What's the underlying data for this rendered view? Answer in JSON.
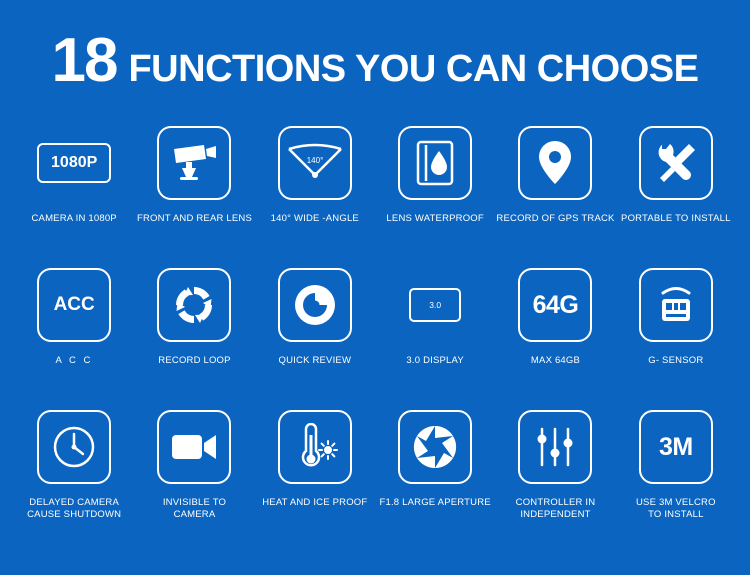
{
  "theme": {
    "background": "#0b64bf",
    "foreground": "#ffffff"
  },
  "heading": {
    "number": "18",
    "text": "FUNCTIONS YOU CAN CHOOSE"
  },
  "features": [
    {
      "id": "camera-1080p",
      "icon": "1080p-badge-icon",
      "tile_text": "1080P",
      "caption": "CAMERA IN 1080P"
    },
    {
      "id": "front-rear-lens",
      "icon": "cctv-camera-icon",
      "tile_text": "",
      "caption": "FRONT AND REAR LENS"
    },
    {
      "id": "wide-angle",
      "icon": "wide-angle-icon",
      "tile_text": "140°",
      "caption": "140° WIDE -ANGLE"
    },
    {
      "id": "lens-waterproof",
      "icon": "waterdrop-icon",
      "tile_text": "",
      "caption": "LENS WATERPROOF"
    },
    {
      "id": "gps-track",
      "icon": "map-pin-icon",
      "tile_text": "",
      "caption": "RECORD OF GPS TRACK"
    },
    {
      "id": "portable-install",
      "icon": "wrench-screwdriver-icon",
      "tile_text": "",
      "caption": "PORTABLE TO INSTALL"
    },
    {
      "id": "acc",
      "icon": "acc-text-icon",
      "tile_text": "ACC",
      "caption": "A C C"
    },
    {
      "id": "record-loop",
      "icon": "loop-arrows-icon",
      "tile_text": "",
      "caption": "RECORD LOOP"
    },
    {
      "id": "quick-review",
      "icon": "play-circle-icon",
      "tile_text": "",
      "caption": "QUICK REVIEW"
    },
    {
      "id": "display-3-0",
      "icon": "screen-icon",
      "tile_text": "3.0",
      "caption": "3.0 DISPLAY"
    },
    {
      "id": "max-64gb",
      "icon": "64g-text-icon",
      "tile_text": "64G",
      "caption": "MAX 64GB"
    },
    {
      "id": "g-sensor",
      "icon": "g-sensor-icon",
      "tile_text": "",
      "caption": "G- SENSOR"
    },
    {
      "id": "delayed-camera",
      "icon": "clock-icon",
      "tile_text": "",
      "caption": "DELAYED CAMERA\nCAUSE SHUTDOWN"
    },
    {
      "id": "invisible-camera",
      "icon": "video-camera-icon",
      "tile_text": "",
      "caption": "INVISIBLE TO\nCAMERA"
    },
    {
      "id": "heat-ice-proof",
      "icon": "thermometer-sun-icon",
      "tile_text": "",
      "caption": "HEAT AND ICE PROOF"
    },
    {
      "id": "large-aperture",
      "icon": "aperture-icon",
      "tile_text": "",
      "caption": "F1.8 LARGE APERTURE"
    },
    {
      "id": "controller",
      "icon": "sliders-icon",
      "tile_text": "",
      "caption": "CONTROLLER IN\nINDEPENDENT"
    },
    {
      "id": "velcro-3m",
      "icon": "3m-text-icon",
      "tile_text": "3M",
      "caption": "USE 3M VELCRO\nTO INSTALL"
    }
  ]
}
